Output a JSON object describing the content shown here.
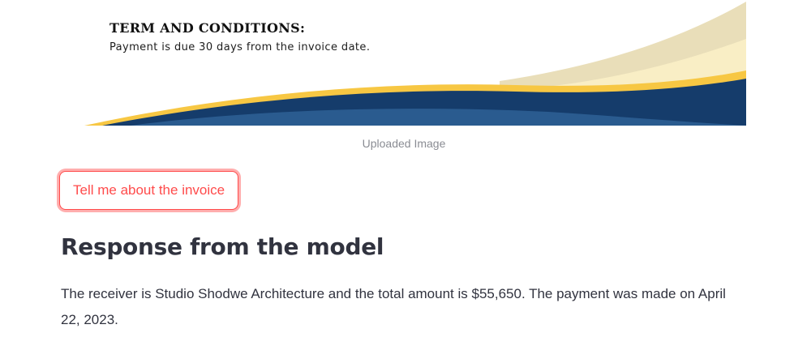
{
  "invoice_image": {
    "terms_title": "TERM AND CONDITIONS:",
    "terms_text": "Payment is due 30 days from the invoice date.",
    "caption": "Uploaded Image"
  },
  "actions": {
    "ask_label": "Tell me about the invoice"
  },
  "response": {
    "heading": "Response from the model",
    "text": "The receiver is Studio Shodwe Architecture and the total amount is $55,650. The payment was made on April 22, 2023."
  },
  "colors": {
    "accent": "#ff4b4b",
    "text": "#31333f",
    "caption": "#8a8c93",
    "wave_navy": "#153c6b",
    "wave_blue": "#2a5b8f",
    "wave_gold": "#f7c743",
    "wave_cream": "#f9eec5",
    "wave_beige": "#e9deb9"
  }
}
